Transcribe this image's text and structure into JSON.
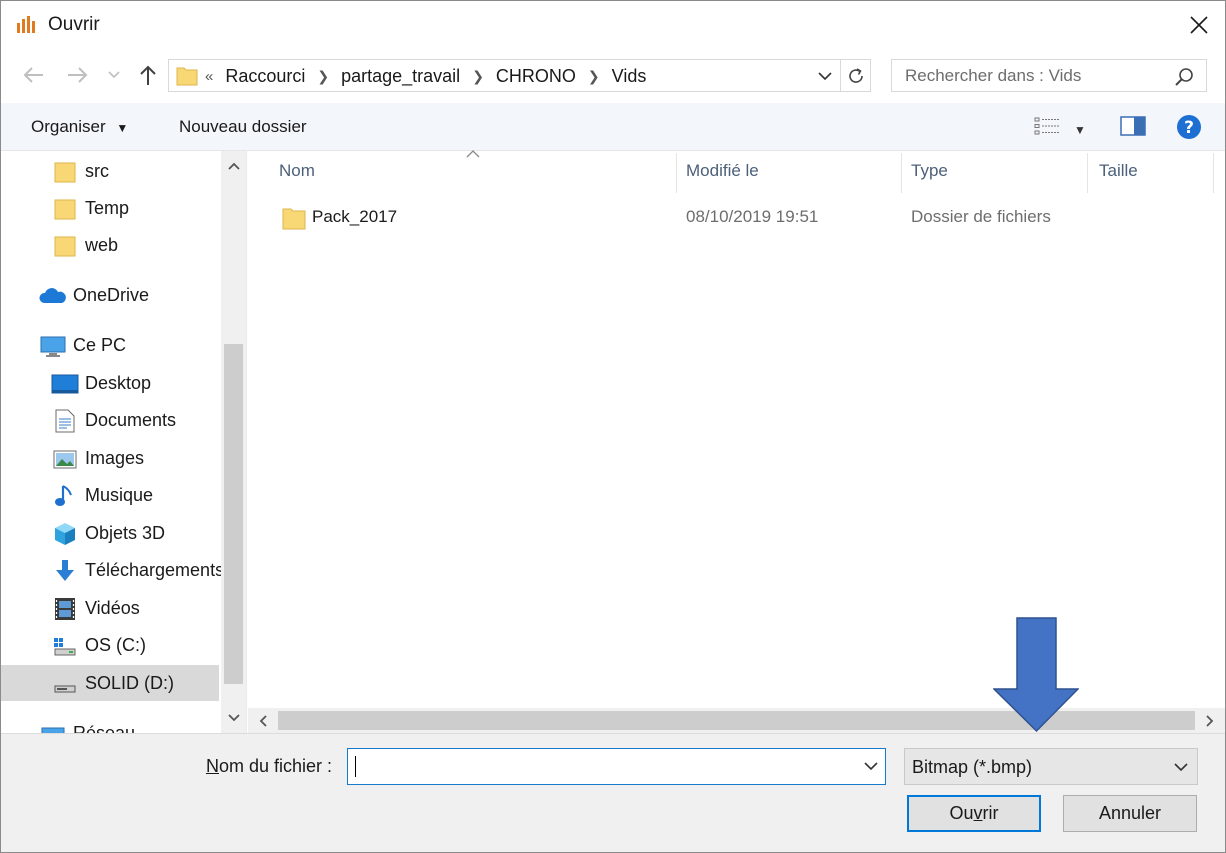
{
  "window": {
    "title": "Ouvrir"
  },
  "nav": {
    "crumb_lead": "«",
    "breadcrumbs": [
      "Raccourci",
      "partage_travail",
      "CHRONO",
      "Vids"
    ],
    "search_placeholder": "Rechercher dans : Vids"
  },
  "toolbar": {
    "organize_label": "Organiser",
    "new_folder_label": "Nouveau dossier"
  },
  "sidebar": {
    "items": [
      {
        "label": "src",
        "icon": "folder-icon"
      },
      {
        "label": "Temp",
        "icon": "folder-icon"
      },
      {
        "label": "web",
        "icon": "folder-icon"
      },
      {
        "label": "OneDrive",
        "icon": "onedrive-cloud-icon"
      },
      {
        "label": "Ce PC",
        "icon": "computer-icon"
      },
      {
        "label": "Desktop",
        "icon": "desktop-icon"
      },
      {
        "label": "Documents",
        "icon": "documents-icon"
      },
      {
        "label": "Images",
        "icon": "images-icon"
      },
      {
        "label": "Musique",
        "icon": "music-note-icon"
      },
      {
        "label": "Objets 3D",
        "icon": "cube-3d-icon"
      },
      {
        "label": "Téléchargements",
        "icon": "download-arrow-icon"
      },
      {
        "label": "Vidéos",
        "icon": "film-icon"
      },
      {
        "label": "OS (C:)",
        "icon": "os-drive-icon"
      },
      {
        "label": "SOLID (D:)",
        "icon": "drive-icon"
      },
      {
        "label": "Réseau",
        "icon": "network-icon"
      }
    ],
    "selected": "SOLID (D:)"
  },
  "file_list": {
    "columns": [
      "Nom",
      "Modifié le",
      "Type",
      "Taille"
    ],
    "rows": [
      {
        "name": "Pack_2017",
        "modified": "08/10/2019 19:51",
        "type": "Dossier de fichiers",
        "size": ""
      }
    ]
  },
  "bottom": {
    "filename_label_accel": "N",
    "filename_label_rest": "om du fichier :",
    "filename_value": "",
    "filter_value": "Bitmap (*.bmp)",
    "open_label_pre": "Ou",
    "open_label_accel": "v",
    "open_label_post": "rir",
    "cancel_label": "Annuler"
  },
  "colors": {
    "accent": "#1979ca",
    "annotation_arrow": "#4472c4",
    "help": "#1e6fd2",
    "folder": "#f8d775"
  }
}
